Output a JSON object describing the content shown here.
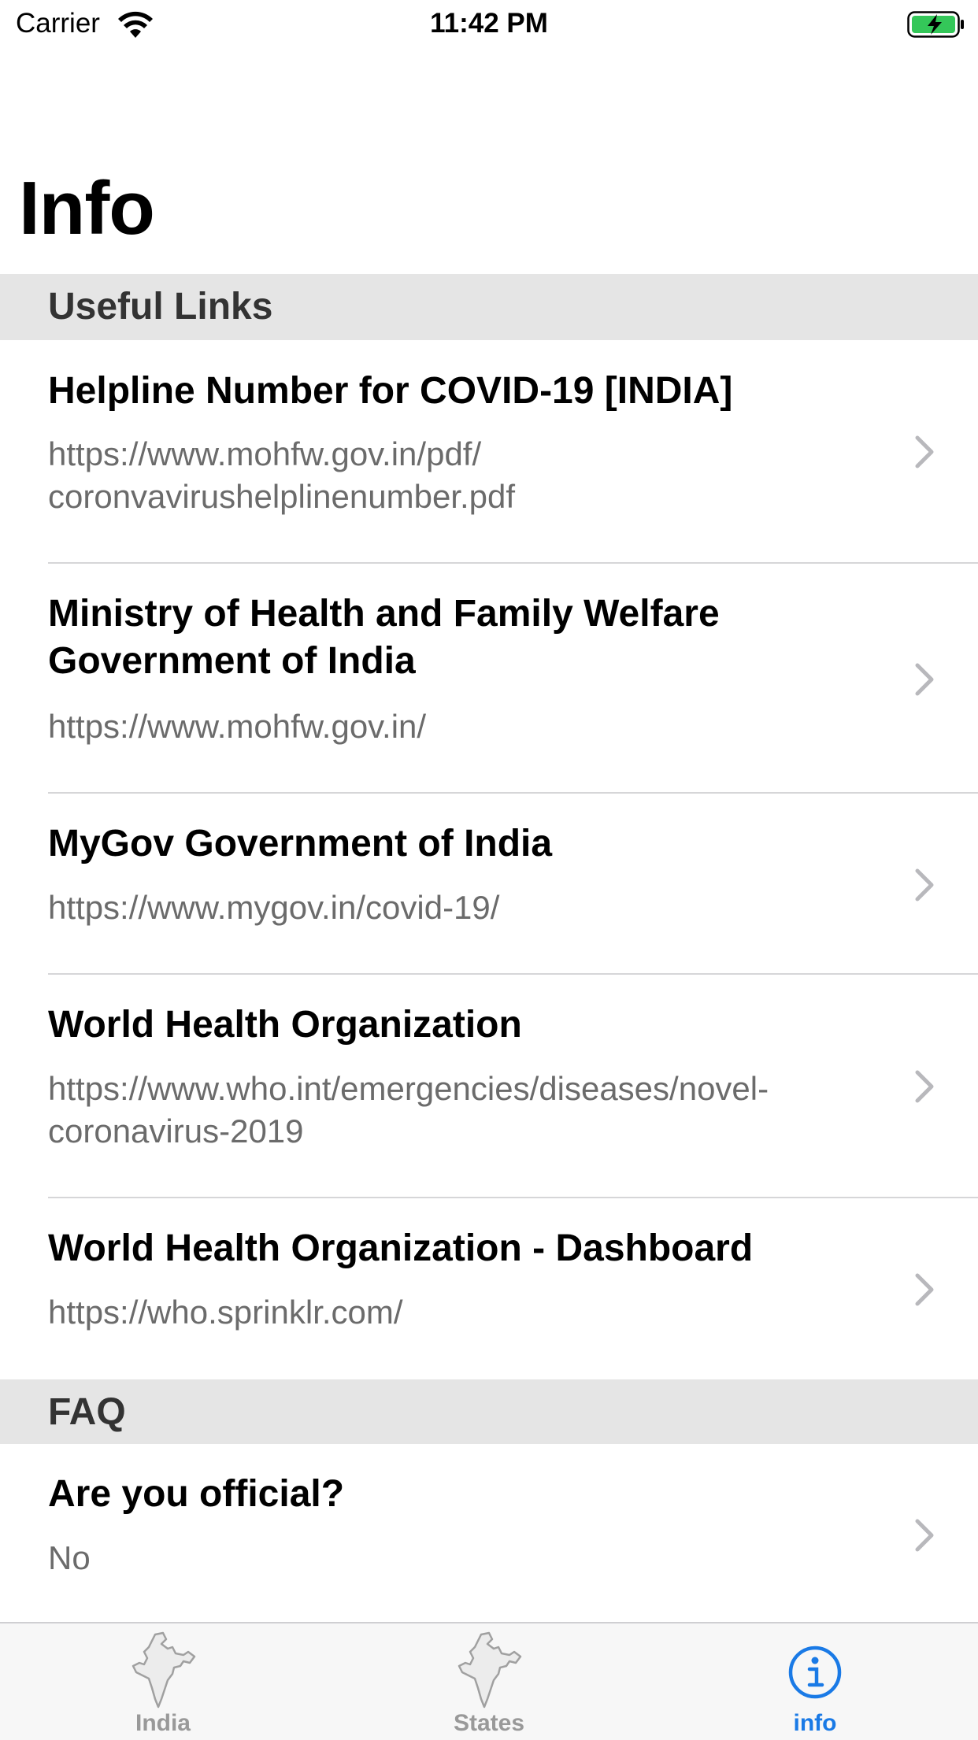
{
  "status_bar": {
    "carrier": "Carrier",
    "time": "11:42 PM"
  },
  "page_title": "Info",
  "sections": [
    {
      "header": "Useful Links",
      "rows": [
        {
          "title": "Helpline Number for COVID-19 [INDIA]",
          "subtitle": "https://www.mohfw.gov.in/pdf/\ncoronvavirushelplinenumber.pdf"
        },
        {
          "title": "Ministry of Health and Family Welfare Government of India",
          "subtitle": "https://www.mohfw.gov.in/"
        },
        {
          "title": "MyGov Government of India",
          "subtitle": "https://www.mygov.in/covid-19/"
        },
        {
          "title": "World Health Organization",
          "subtitle": "https://www.who.int/emergencies/diseases/novel-coronavirus-2019"
        },
        {
          "title": "World Health Organization - Dashboard",
          "subtitle": "https://who.sprinklr.com/"
        }
      ]
    },
    {
      "header": "FAQ",
      "rows": [
        {
          "title": "Are you official?",
          "subtitle": "No"
        }
      ]
    }
  ],
  "tab_bar": {
    "tabs": [
      {
        "label": "India",
        "icon": "india-map-icon",
        "active": false
      },
      {
        "label": "States",
        "icon": "india-map-icon",
        "active": false
      },
      {
        "label": "info",
        "icon": "info-circle-icon",
        "active": true
      }
    ]
  },
  "colors": {
    "accent": "#1a7ae6",
    "section_bg": "#e5e5e5",
    "subtitle": "#6b6b6b",
    "battery_green": "#34c759"
  }
}
